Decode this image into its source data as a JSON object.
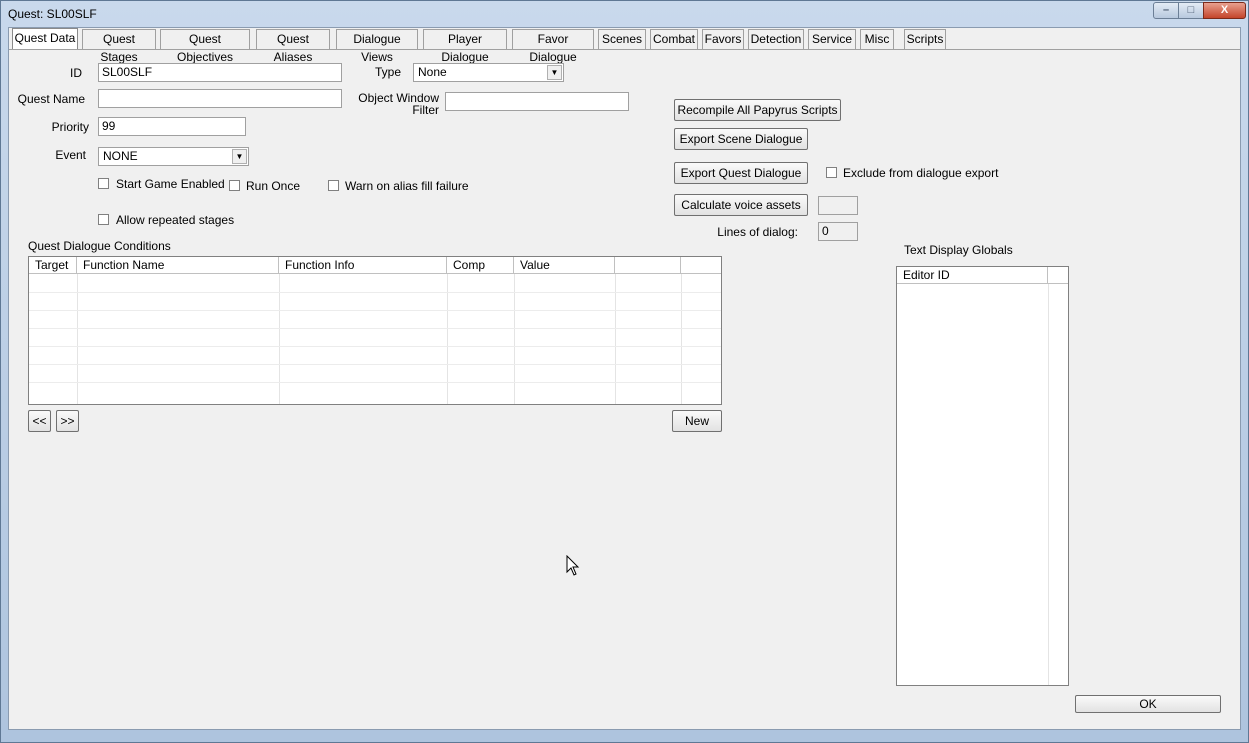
{
  "window": {
    "title": "Quest: SL00SLF",
    "minimize": "–",
    "maximize": "□",
    "close": "X"
  },
  "tabs": [
    {
      "label": "Quest Data",
      "active": true
    },
    {
      "label": "Quest Stages"
    },
    {
      "label": "Quest Objectives"
    },
    {
      "label": "Quest Aliases"
    },
    {
      "label": "Dialogue Views"
    },
    {
      "label": "Player Dialogue"
    },
    {
      "label": "Favor Dialogue"
    },
    {
      "label": "Scenes"
    },
    {
      "label": "Combat"
    },
    {
      "label": "Favors"
    },
    {
      "label": "Detection"
    },
    {
      "label": "Service"
    },
    {
      "label": "Misc"
    },
    {
      "label": "Scripts"
    }
  ],
  "form": {
    "id_label": "ID",
    "id_value": "SL00SLF",
    "type_label": "Type",
    "type_value": "None",
    "quest_name_label": "Quest Name",
    "quest_name_value": "",
    "object_window_label_1": "Object Window",
    "object_window_label_2": "Filter",
    "object_window_value": "",
    "priority_label": "Priority",
    "priority_value": "99",
    "event_label": "Event",
    "event_value": "NONE",
    "start_game_enabled": "Start Game Enabled",
    "run_once": "Run Once",
    "warn_alias": "Warn on alias fill failure",
    "allow_repeated": "Allow repeated stages"
  },
  "buttons": {
    "recompile": "Recompile All Papyrus Scripts",
    "export_scene": "Export Scene Dialogue",
    "export_quest": "Export Quest Dialogue",
    "exclude_label": "Exclude from dialogue export",
    "calc_voice": "Calculate voice assets",
    "calc_value": "",
    "lines_label": "Lines of dialog:",
    "lines_value": "0",
    "prev": "<<",
    "next": ">>",
    "new": "New",
    "ok": "OK"
  },
  "conditions": {
    "title": "Quest Dialogue Conditions",
    "columns": [
      "Target",
      "Function Name",
      "Function Info",
      "Comp",
      "Value",
      ""
    ]
  },
  "globals": {
    "title": "Text Display Globals",
    "columns": [
      "Editor ID"
    ]
  }
}
